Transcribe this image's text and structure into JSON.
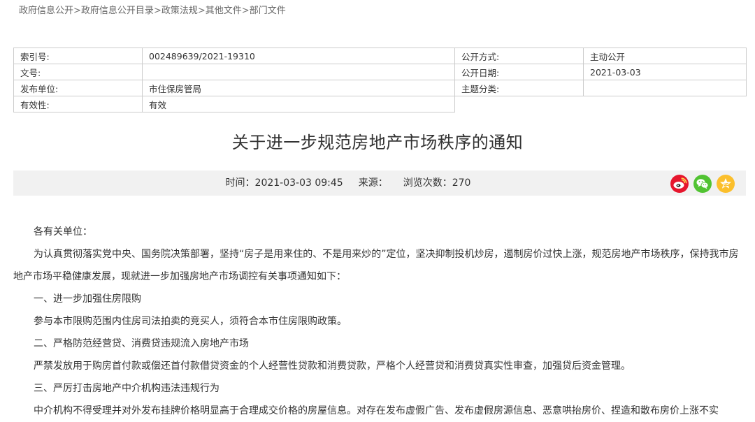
{
  "breadcrumb": {
    "items": [
      "政府信息公开",
      "政府信息公开目录",
      "政策法规",
      "其他文件",
      "部门文件"
    ],
    "separator": ">"
  },
  "meta": {
    "index_label": "索引号:",
    "index_value": "002489639/2021-19310",
    "disclosure_label": "公开方式:",
    "disclosure_value": "主动公开",
    "doc_no_label": "文号:",
    "doc_no_value": "",
    "date_label": "公开日期:",
    "date_value": "2021-03-03",
    "issuer_label": "发布单位:",
    "issuer_value": "市住保房管局",
    "topic_label": "主题分类:",
    "topic_value": "",
    "validity_label": "有效性:",
    "validity_value": "有效"
  },
  "article": {
    "title": "关于进一步规范房地产市场秩序的通知",
    "time_text": "时间：2021-03-03 09:45",
    "source_text": "来源：",
    "views_text": "浏览次数：270"
  },
  "share": {
    "icons": [
      "weibo-icon",
      "wechat-icon",
      "qzone-icon"
    ],
    "colors": {
      "weibo": "#e6162d",
      "wechat": "#51c332",
      "qzone": "#fbbf2c"
    }
  },
  "body": {
    "paragraphs": [
      "各有关单位：",
      "为认真贯彻落实党中央、国务院决策部署，坚持“房子是用来住的、不是用来炒的”定位，坚决抑制投机炒房，遏制房价过快上涨，规范房地产市场秩序，保持我市房地产市场平稳健康发展，现就进一步加强房地产市场调控有关事项通知如下：",
      "一、进一步加强住房限购",
      "参与本市限购范围内住房司法拍卖的竞买人，须符合本市住房限购政策。",
      "二、严格防范经营贷、消费贷违规流入房地产市场",
      "严禁发放用于购房首付款或偿还首付款借贷资金的个人经营性贷款和消费贷款，严格个人经营贷和消费贷真实性审查，加强贷后资金管理。",
      "三、严厉打击房地产中介机构违法违规行为",
      "中介机构不得受理并对外发布挂牌价格明显高于合理成交价格的房屋信息。对存在发布虚假广告、发布虚假房源信息、恶意哄抬房价、捏造和散布房价上涨不实"
    ]
  }
}
